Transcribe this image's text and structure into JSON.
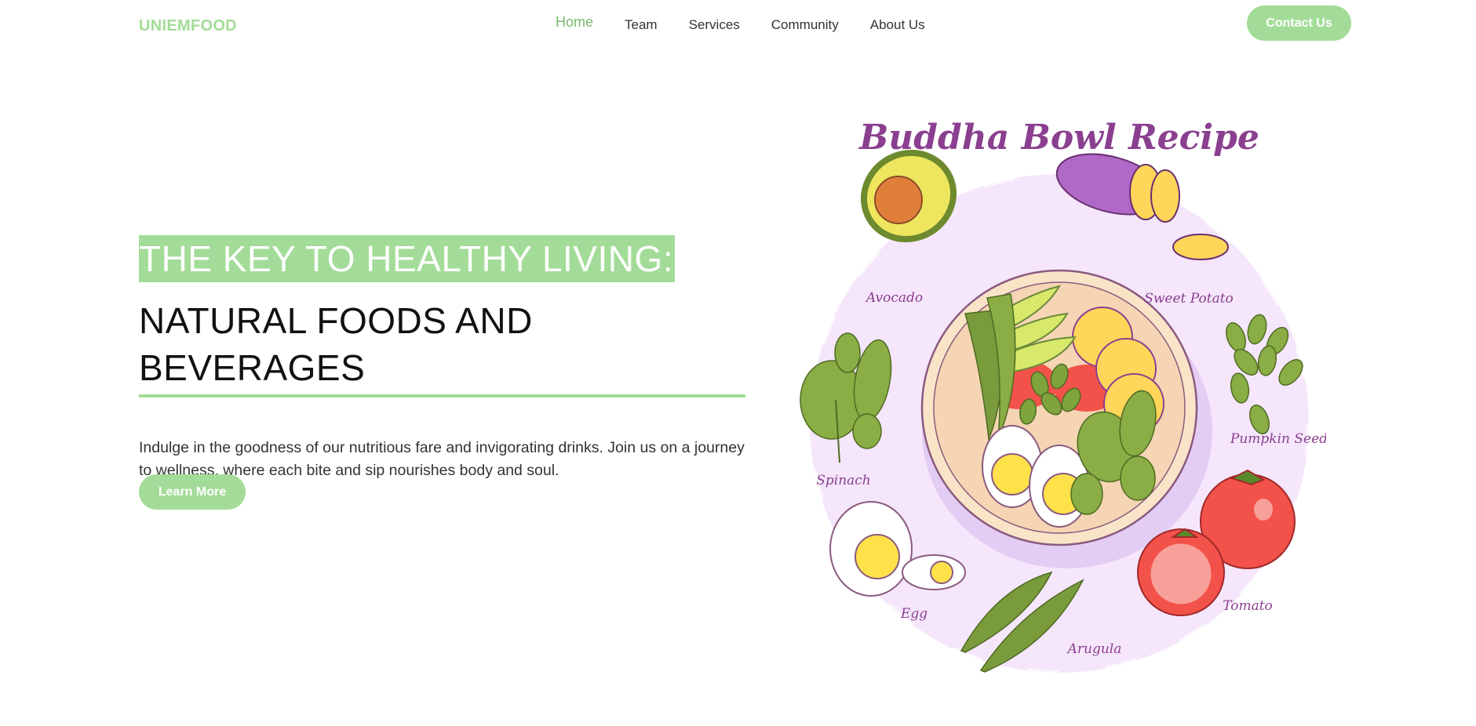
{
  "brand": "UNIEMFOOD",
  "nav": {
    "items": [
      {
        "label": "Home",
        "active": true
      },
      {
        "label": "Team"
      },
      {
        "label": "Services"
      },
      {
        "label": "Community"
      },
      {
        "label": "About Us"
      }
    ],
    "contact_label": "Contact Us"
  },
  "hero": {
    "title_highlight": "THE KEY TO HEALTHY LIVING:",
    "title_main": "NATURAL FOODS AND BEVERAGES",
    "description": "Indulge in the goodness of our nutritious fare and invigorating drinks. Join us on a journey to wellness, where each bite and sip nourishes body and soul.",
    "button_label": "Learn More"
  },
  "illustration": {
    "title": "Buddha Bowl Recipe",
    "labels": {
      "avocado": "Avocado",
      "sweet_potato": "Sweet Potato",
      "pumpkin_seed": "Pumpkin Seed",
      "spinach": "Spinach",
      "tomato": "Tomato",
      "egg": "Egg",
      "arugula": "Arugula"
    }
  },
  "colors": {
    "accent": "#a3dc98",
    "active_link": "#7ab86f",
    "illustration_bg": "#f5e6fb",
    "script_purple": "#8a3f8f"
  }
}
